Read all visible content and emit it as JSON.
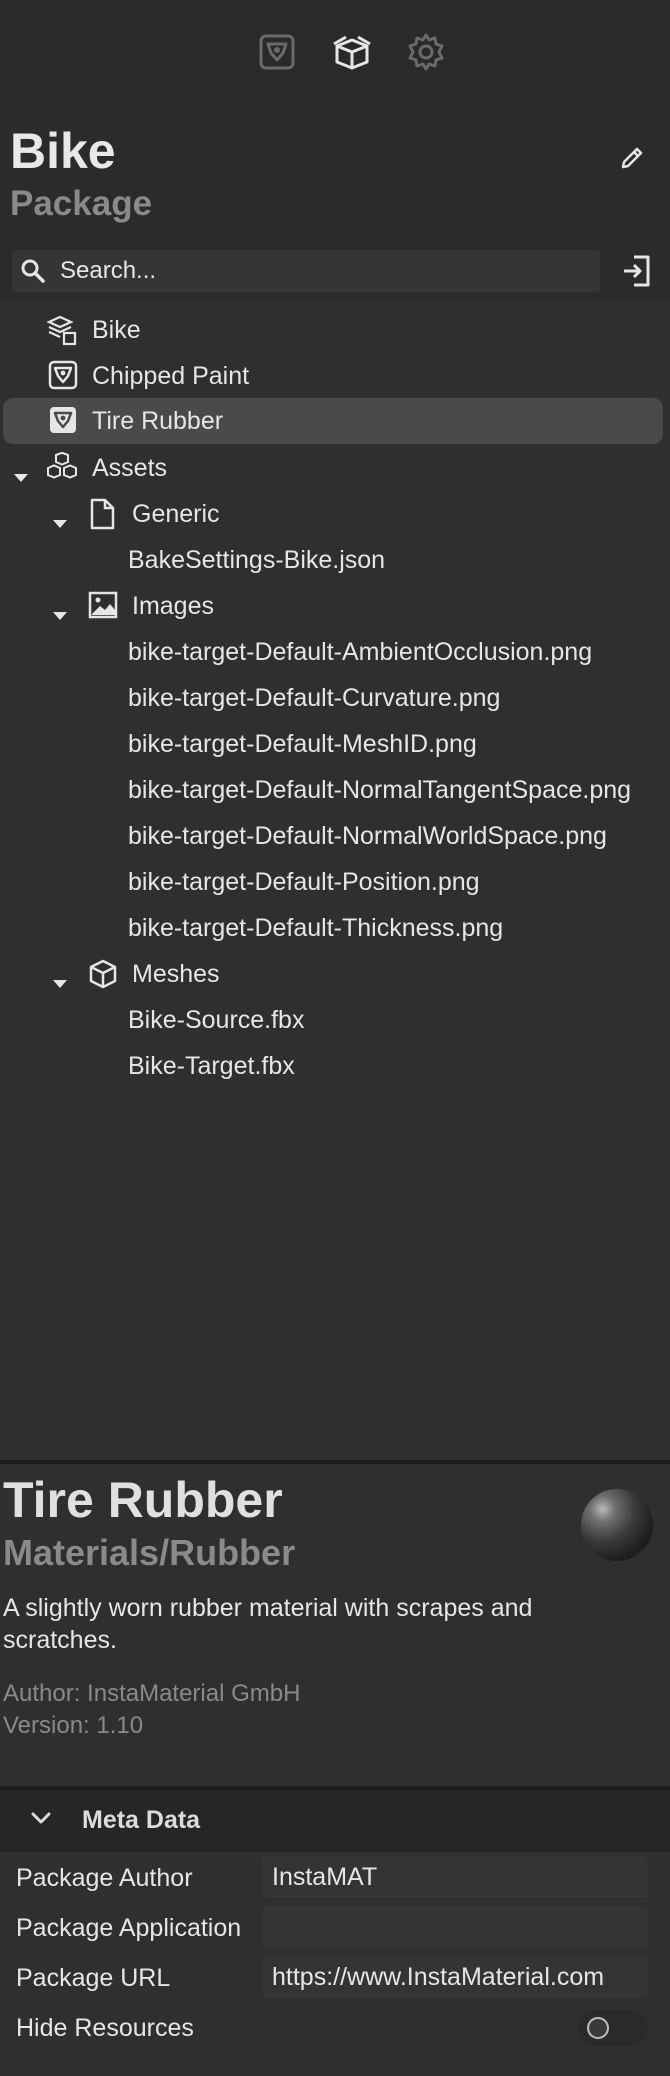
{
  "toolbar": {
    "icons": [
      "material-icon",
      "package-icon",
      "gear-icon"
    ]
  },
  "header": {
    "title": "Bike",
    "subtitle": "Package"
  },
  "search": {
    "placeholder": "Search..."
  },
  "tree": {
    "items": [
      {
        "label": "Bike",
        "icon": "layers-box-icon"
      },
      {
        "label": "Chipped  Paint",
        "icon": "material-icon"
      },
      {
        "label": "Tire Rubber",
        "icon": "material-icon",
        "selected": true
      },
      {
        "label": "Assets",
        "icon": "boxes-icon",
        "expanded": true
      },
      {
        "label": "Generic",
        "icon": "document-icon",
        "expanded": true
      },
      {
        "label": "BakeSettings-Bike.json"
      },
      {
        "label": "Images",
        "icon": "image-icon",
        "expanded": true
      },
      {
        "label": "bike-target-Default-AmbientOcclusion.png"
      },
      {
        "label": "bike-target-Default-Curvature.png"
      },
      {
        "label": "bike-target-Default-MeshID.png"
      },
      {
        "label": "bike-target-Default-NormalTangentSpace.png"
      },
      {
        "label": "bike-target-Default-NormalWorldSpace.png"
      },
      {
        "label": "bike-target-Default-Position.png"
      },
      {
        "label": "bike-target-Default-Thickness.png"
      },
      {
        "label": "Meshes",
        "icon": "cube-icon",
        "expanded": true
      },
      {
        "label": "Bike-Source.fbx"
      },
      {
        "label": "Bike-Target.fbx"
      }
    ]
  },
  "details": {
    "title": "Tire Rubber",
    "category": "Materials/Rubber",
    "description": "A slightly worn rubber material with scrapes and scratches.",
    "author": "Author: InstaMaterial GmbH",
    "version": "Version: 1.10"
  },
  "metadata": {
    "heading": "Meta Data",
    "package_author_label": "Package Author",
    "package_author_value": "InstaMAT",
    "package_application_label": "Package Application",
    "package_application_value": "",
    "package_url_label": "Package URL",
    "package_url_value": "https://www.InstaMaterial.com",
    "hide_resources_label": "Hide Resources",
    "hide_resources_on": false
  },
  "colors": {
    "background": "#2b2b2b",
    "panel": "#2f2f2f",
    "selected_row": "#4a4a4a",
    "muted_text": "#8a8a8a"
  }
}
